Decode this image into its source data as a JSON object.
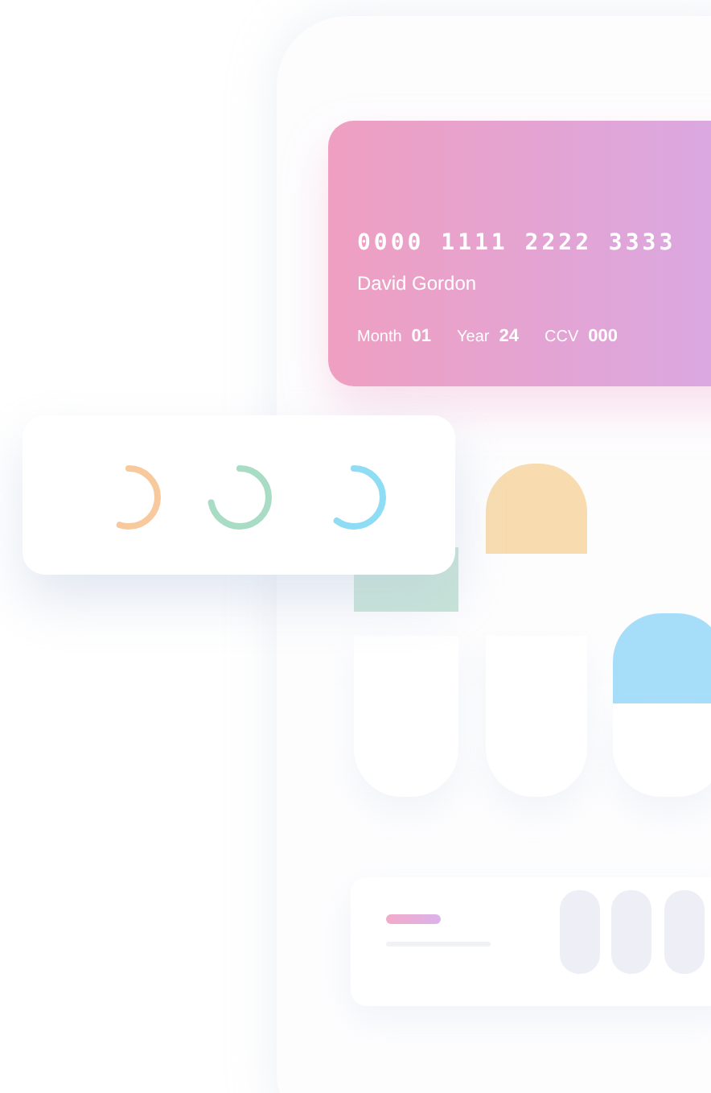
{
  "card": {
    "number": "0000 1111 2222 3333",
    "holder": "David Gordon",
    "fields": [
      {
        "label": "Month",
        "value": "01"
      },
      {
        "label": "Year",
        "value": "24"
      },
      {
        "label": "CCV",
        "value": "000"
      }
    ]
  },
  "rings": [
    {
      "level": 0.55,
      "color": "#f9c99e"
    },
    {
      "level": 0.72,
      "color": "#a9dcc4"
    },
    {
      "level": 0.6,
      "color": "#8fdcf5"
    }
  ],
  "tiles": [
    {
      "kind": "block",
      "color": "#c6e4d6"
    },
    {
      "kind": "dome",
      "color": "#f8dcb0"
    },
    {
      "kind": "dome",
      "color": "#a6def9"
    }
  ]
}
